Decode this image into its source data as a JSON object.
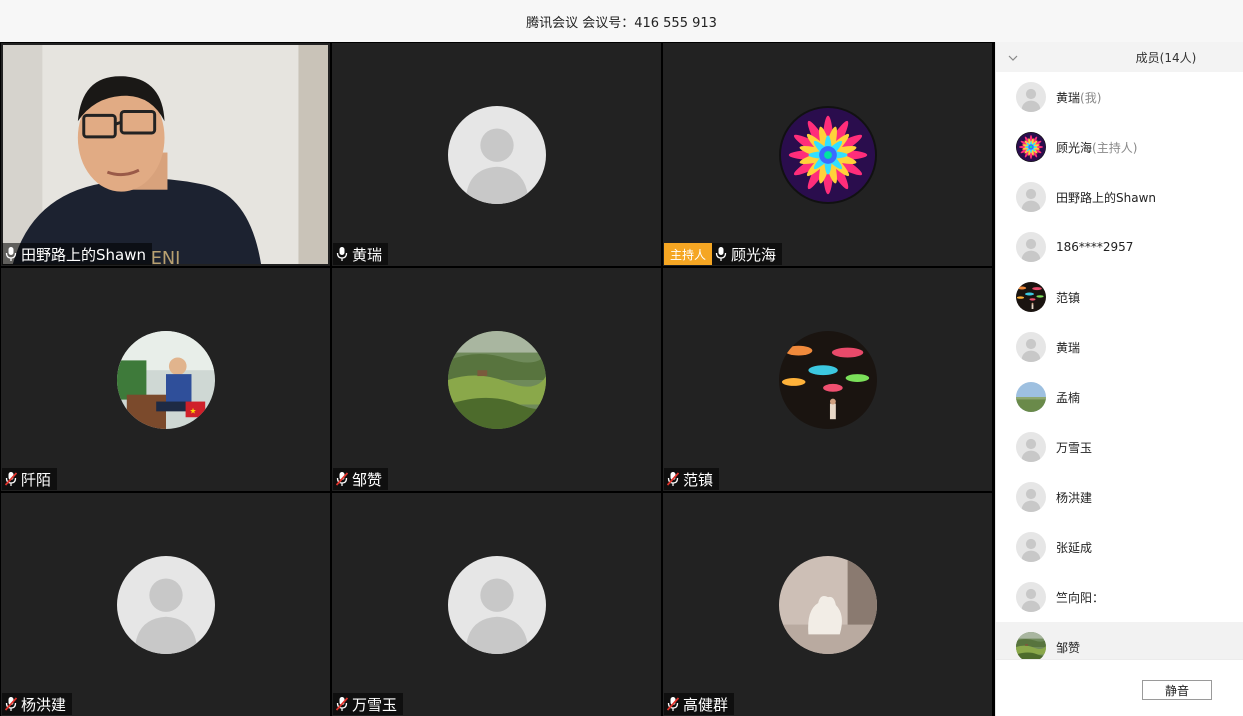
{
  "titlebar": {
    "title": "腾讯会议 会议号：416 555 913"
  },
  "colors": {
    "tile_bg": "#222222",
    "host_badge": "#f5a623",
    "panel_header_bg": "#f3f3f3"
  },
  "tiles": [
    {
      "name": "田野路上的Shawn",
      "mic": "on",
      "kind": "video",
      "host": false
    },
    {
      "name": "黄瑞",
      "mic": "on",
      "kind": "default-avatar",
      "host": false
    },
    {
      "name": "顾光海",
      "mic": "on",
      "kind": "mandala-avatar",
      "host": true,
      "host_label": "主持人"
    },
    {
      "name": "阡陌",
      "mic": "muted",
      "kind": "photo-avatar",
      "host": false
    },
    {
      "name": "邹赞",
      "mic": "muted",
      "kind": "landscape-avatar",
      "host": false
    },
    {
      "name": "范镇",
      "mic": "muted",
      "kind": "umbrella-avatar",
      "host": false
    },
    {
      "name": "杨洪建",
      "mic": "muted",
      "kind": "default-avatar",
      "host": false
    },
    {
      "name": "万雪玉",
      "mic": "muted",
      "kind": "default-avatar",
      "host": false
    },
    {
      "name": "高健群",
      "mic": "muted",
      "kind": "sculpture-avatar",
      "host": false
    }
  ],
  "panel": {
    "title": "成员(14人)",
    "mute_button": "静音",
    "members": [
      {
        "name": "黄瑞",
        "suffix": "(我)",
        "avatar": "default"
      },
      {
        "name": "顾光海",
        "suffix": "(主持人)",
        "avatar": "mandala"
      },
      {
        "name": "田野路上的Shawn",
        "suffix": "",
        "avatar": "default"
      },
      {
        "name": "186****2957",
        "suffix": "",
        "avatar": "default"
      },
      {
        "name": "范镇",
        "suffix": "",
        "avatar": "umbrella"
      },
      {
        "name": "黄瑞",
        "suffix": "",
        "avatar": "default"
      },
      {
        "name": "孟楠",
        "suffix": "",
        "avatar": "landscape-sky"
      },
      {
        "name": "万雪玉",
        "suffix": "",
        "avatar": "default"
      },
      {
        "name": "杨洪建",
        "suffix": "",
        "avatar": "default"
      },
      {
        "name": "张延成",
        "suffix": "",
        "avatar": "default"
      },
      {
        "name": "竺向阳：",
        "suffix": "",
        "avatar": "default"
      },
      {
        "name": "邹赞",
        "suffix": "",
        "avatar": "landscape"
      }
    ]
  }
}
